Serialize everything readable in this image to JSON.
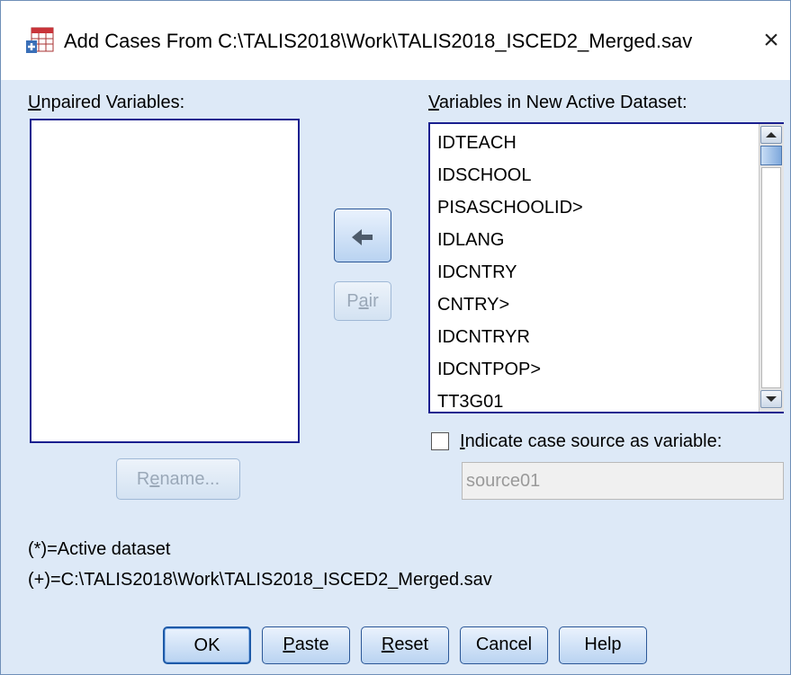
{
  "window": {
    "title": "Add Cases From C:\\TALIS2018\\Work\\TALIS2018_ISCED2_Merged.sav",
    "close_glyph": "×"
  },
  "unpaired": {
    "label_mnemonic": "U",
    "label_rest": "npaired Variables:"
  },
  "active_dataset": {
    "label_mnemonic": "V",
    "label_rest": "ariables in New Active Dataset:",
    "items": [
      "IDTEACH",
      "IDSCHOOL",
      "PISASCHOOLID>",
      "IDLANG",
      "IDCNTRY",
      "CNTRY>",
      "IDCNTRYR",
      "IDCNTPOP>",
      "TT3G01"
    ]
  },
  "buttons": {
    "move_arrow": "🡄",
    "pair_pre": "P",
    "pair_mnemonic": "a",
    "pair_post": "ir",
    "rename_pre": "R",
    "rename_mnemonic": "e",
    "rename_post": "name...",
    "ok": "OK",
    "paste_mnemonic": "P",
    "paste_rest": "aste",
    "reset_mnemonic": "R",
    "reset_rest": "eset",
    "cancel": "Cancel",
    "help": "Help"
  },
  "case_source": {
    "checked": false,
    "label_mnemonic": "I",
    "label_rest": "ndicate case source as variable:",
    "field_value": "source01"
  },
  "legend": {
    "active": "(*)=Active dataset",
    "plus": "(+)=C:\\TALIS2018\\Work\\TALIS2018_ISCED2_Merged.sav"
  },
  "colors": {
    "dialog_bg": "#dde9f7",
    "list_border": "#1a1f8f",
    "button_border": "#2b5797"
  },
  "icons": {
    "app": "spss-add-cases-icon",
    "close": "close-icon",
    "move": "arrow-left-icon",
    "scroll_up": "chevron-up-icon",
    "scroll_down": "chevron-down-icon"
  }
}
